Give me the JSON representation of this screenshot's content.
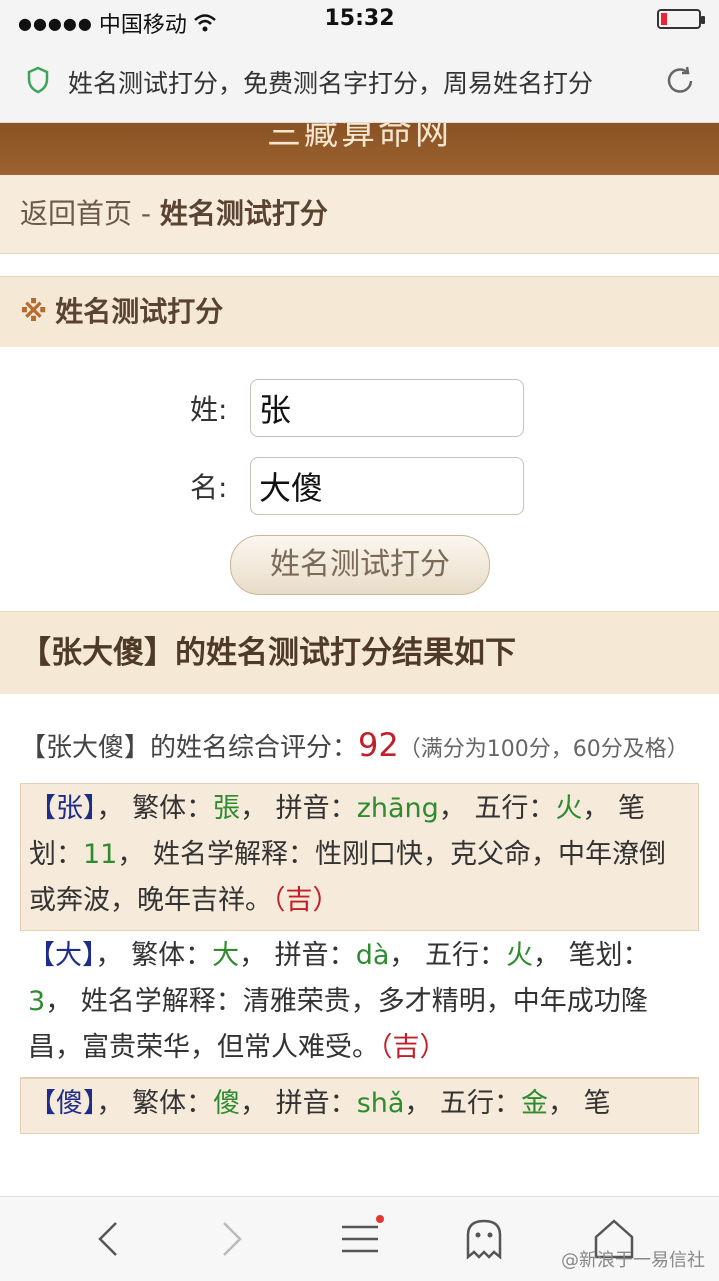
{
  "status": {
    "carrier": "中国移动",
    "time": "15:32"
  },
  "browser": {
    "page_title": "姓名测试打分，免费测名字打分，周易姓名打分"
  },
  "site": {
    "name": "三藏算命网",
    "breadcrumb_home": "返回首页",
    "breadcrumb_sep": " - ",
    "breadcrumb_current": "姓名测试打分"
  },
  "form": {
    "section_mark": "※",
    "section_title": "姓名测试打分",
    "surname_label": "姓:",
    "surname_value": "张",
    "given_label": "名:",
    "given_value": "大傻",
    "submit_label": "姓名测试打分"
  },
  "result": {
    "heading": "【张大傻】的姓名测试打分结果如下",
    "score_prefix": "【张大傻】的姓名综合评分：",
    "score": "92",
    "score_note": "（满分为100分，60分及格）",
    "entries": [
      {
        "char": "【张】",
        "trad_label": "， 繁体：",
        "trad": "張",
        "pinyin_label": "， 拼音：",
        "pinyin": "zhāng",
        "wuxing_label": "， 五行：",
        "wuxing": "火",
        "strokes_label": "， 笔划：",
        "strokes": "11",
        "meaning_label": "， 姓名学解释：",
        "meaning": "性刚口快，克父命，中年潦倒或奔波，晚年吉祥。",
        "luck": "（吉）"
      },
      {
        "char": "【大】",
        "trad_label": "， 繁体：",
        "trad": "大",
        "pinyin_label": "， 拼音：",
        "pinyin": "dà",
        "wuxing_label": "， 五行：",
        "wuxing": "火",
        "strokes_label": "， 笔划：",
        "strokes": "3",
        "meaning_label": "， 姓名学解释：",
        "meaning": "清雅荣贵，多才精明，中年成功隆昌，富贵荣华，但常人难受。",
        "luck": "（吉）"
      },
      {
        "char": "【傻】",
        "trad_label": "， 繁体：",
        "trad": "傻",
        "pinyin_label": "， 拼音：",
        "pinyin": "shǎ",
        "wuxing_label": "， 五行：",
        "wuxing": "金",
        "strokes_label": "， 笔"
      }
    ]
  },
  "watermark": "@新浪于一易信社",
  "icons": [
    "wifi-icon",
    "battery-icon",
    "shield-icon",
    "reload-icon",
    "back-icon",
    "forward-icon",
    "menu-icon",
    "ghost-icon",
    "home-icon"
  ],
  "colors": {
    "header_brown": "#8a5223",
    "section_bg": "#f5e9d6",
    "score_red": "#c0202a",
    "value_green": "#2e8b2e",
    "char_blue": "#1f2d8a"
  }
}
